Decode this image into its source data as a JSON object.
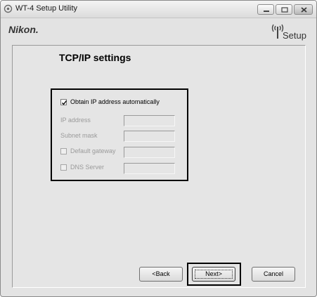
{
  "window": {
    "title": "WT-4 Setup Utility"
  },
  "header": {
    "logo": "Nikon.",
    "setup_label": "Setup"
  },
  "page": {
    "title": "TCP/IP settings"
  },
  "settings": {
    "obtain_auto": {
      "label": "Obtain IP address automatically",
      "checked": true
    },
    "ip_address": {
      "label": "IP address",
      "value": ""
    },
    "subnet_mask": {
      "label": "Subnet mask",
      "value": ""
    },
    "default_gateway": {
      "label": "Default gateway",
      "checked": false,
      "value": ""
    },
    "dns_server": {
      "label": "DNS Server",
      "checked": false,
      "value": ""
    }
  },
  "buttons": {
    "back": "<Back",
    "next": "Next>",
    "cancel": "Cancel"
  }
}
